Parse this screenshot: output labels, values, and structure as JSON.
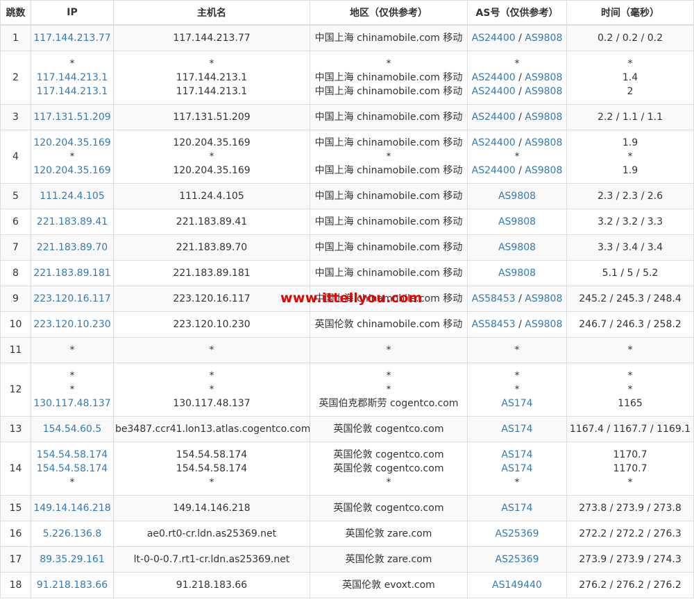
{
  "headers": [
    "跳数",
    "IP",
    "主机名",
    "地区（仅供参考）",
    "AS号（仅供参考）",
    "时间（毫秒）"
  ],
  "watermark": "www.ittellyou.com",
  "rows": [
    {
      "hop": "1",
      "ip": [
        "117.144.213.77"
      ],
      "host": [
        "117.144.213.77"
      ],
      "region": [
        "中国上海 chinamobile.com 移动"
      ],
      "asn": [
        [
          "AS24400",
          "AS9808"
        ]
      ],
      "time": [
        "0.2 / 0.2 / 0.2"
      ]
    },
    {
      "hop": "2",
      "ip": [
        "*",
        "117.144.213.1",
        "117.144.213.1"
      ],
      "host": [
        "*",
        "117.144.213.1",
        "117.144.213.1"
      ],
      "region": [
        "*",
        "中国上海 chinamobile.com 移动",
        "中国上海 chinamobile.com 移动"
      ],
      "asn": [
        [
          "*"
        ],
        [
          "AS24400",
          "AS9808"
        ],
        [
          "AS24400",
          "AS9808"
        ]
      ],
      "time": [
        "*",
        "1.4",
        "2"
      ]
    },
    {
      "hop": "3",
      "ip": [
        "117.131.51.209"
      ],
      "host": [
        "117.131.51.209"
      ],
      "region": [
        "中国上海 chinamobile.com 移动"
      ],
      "asn": [
        [
          "AS24400",
          "AS9808"
        ]
      ],
      "time": [
        "2.2 / 1.1 / 1.1"
      ]
    },
    {
      "hop": "4",
      "ip": [
        "120.204.35.169",
        "*",
        "120.204.35.169"
      ],
      "host": [
        "120.204.35.169",
        "*",
        "120.204.35.169"
      ],
      "region": [
        "中国上海 chinamobile.com 移动",
        "*",
        "中国上海 chinamobile.com 移动"
      ],
      "asn": [
        [
          "AS24400",
          "AS9808"
        ],
        [
          "*"
        ],
        [
          "AS24400",
          "AS9808"
        ]
      ],
      "time": [
        "1.9",
        "*",
        "1.9"
      ]
    },
    {
      "hop": "5",
      "ip": [
        "111.24.4.105"
      ],
      "host": [
        "111.24.4.105"
      ],
      "region": [
        "中国上海 chinamobile.com 移动"
      ],
      "asn": [
        [
          "AS9808"
        ]
      ],
      "time": [
        "2.3 / 2.3 / 2.6"
      ]
    },
    {
      "hop": "6",
      "ip": [
        "221.183.89.41"
      ],
      "host": [
        "221.183.89.41"
      ],
      "region": [
        "中国上海 chinamobile.com 移动"
      ],
      "asn": [
        [
          "AS9808"
        ]
      ],
      "time": [
        "3.2 / 3.2 / 3.3"
      ]
    },
    {
      "hop": "7",
      "ip": [
        "221.183.89.70"
      ],
      "host": [
        "221.183.89.70"
      ],
      "region": [
        "中国上海 chinamobile.com 移动"
      ],
      "asn": [
        [
          "AS9808"
        ]
      ],
      "time": [
        "3.3 / 3.4 / 3.4"
      ]
    },
    {
      "hop": "8",
      "ip": [
        "221.183.89.181"
      ],
      "host": [
        "221.183.89.181"
      ],
      "region": [
        "中国上海 chinamobile.com 移动"
      ],
      "asn": [
        [
          "AS9808"
        ]
      ],
      "time": [
        "5.1 / 5 / 5.2"
      ]
    },
    {
      "hop": "9",
      "ip": [
        "223.120.16.117"
      ],
      "host": [
        "223.120.16.117"
      ],
      "region": [
        "中国上海 chinamobile.com 移动"
      ],
      "asn": [
        [
          "AS58453",
          "AS9808"
        ]
      ],
      "time": [
        "245.2 / 245.3 / 248.4"
      ]
    },
    {
      "hop": "10",
      "ip": [
        "223.120.10.230"
      ],
      "host": [
        "223.120.10.230"
      ],
      "region": [
        "英国伦敦 chinamobile.com 移动"
      ],
      "asn": [
        [
          "AS58453",
          "AS9808"
        ]
      ],
      "time": [
        "246.7 / 246.3 / 258.2"
      ]
    },
    {
      "hop": "11",
      "ip": [
        "*"
      ],
      "host": [
        "*"
      ],
      "region": [
        "*"
      ],
      "asn": [
        [
          "*"
        ]
      ],
      "time": [
        "*"
      ]
    },
    {
      "hop": "12",
      "ip": [
        "*",
        "*",
        "130.117.48.137"
      ],
      "host": [
        "*",
        "*",
        "130.117.48.137"
      ],
      "region": [
        "*",
        "*",
        "英国伯克郡斯劳 cogentco.com"
      ],
      "asn": [
        [
          "*"
        ],
        [
          "*"
        ],
        [
          "AS174"
        ]
      ],
      "time": [
        "*",
        "*",
        "1165"
      ]
    },
    {
      "hop": "13",
      "ip": [
        "154.54.60.5"
      ],
      "host": [
        "be3487.ccr41.lon13.atlas.cogentco.com"
      ],
      "region": [
        "英国伦敦 cogentco.com"
      ],
      "asn": [
        [
          "AS174"
        ]
      ],
      "time": [
        "1167.4 / 1167.7 / 1169.1"
      ]
    },
    {
      "hop": "14",
      "ip": [
        "154.54.58.174",
        "154.54.58.174",
        "*"
      ],
      "host": [
        "154.54.58.174",
        "154.54.58.174",
        "*"
      ],
      "region": [
        "英国伦敦 cogentco.com",
        "英国伦敦 cogentco.com",
        "*"
      ],
      "asn": [
        [
          "AS174"
        ],
        [
          "AS174"
        ],
        [
          "*"
        ]
      ],
      "time": [
        "1170.7",
        "1170.7",
        "*"
      ]
    },
    {
      "hop": "15",
      "ip": [
        "149.14.146.218"
      ],
      "host": [
        "149.14.146.218"
      ],
      "region": [
        "英国伦敦 cogentco.com"
      ],
      "asn": [
        [
          "AS174"
        ]
      ],
      "time": [
        "273.8 / 273.9 / 273.8"
      ]
    },
    {
      "hop": "16",
      "ip": [
        "5.226.136.8"
      ],
      "host": [
        "ae0.rt0-cr.ldn.as25369.net"
      ],
      "region": [
        "英国伦敦 zare.com"
      ],
      "asn": [
        [
          "AS25369"
        ]
      ],
      "time": [
        "272.2 / 272.2 / 276.3"
      ]
    },
    {
      "hop": "17",
      "ip": [
        "89.35.29.161"
      ],
      "host": [
        "lt-0-0-0.7.rt1-cr.ldn.as25369.net"
      ],
      "region": [
        "英国伦敦 zare.com"
      ],
      "asn": [
        [
          "AS25369"
        ]
      ],
      "time": [
        "273.9 / 273.9 / 274.3"
      ]
    },
    {
      "hop": "18",
      "ip": [
        "91.218.183.66"
      ],
      "host": [
        "91.218.183.66"
      ],
      "region": [
        "英国伦敦 evoxt.com"
      ],
      "asn": [
        [
          "AS149440"
        ]
      ],
      "time": [
        "276.2 / 276.2 / 276.2"
      ]
    }
  ]
}
